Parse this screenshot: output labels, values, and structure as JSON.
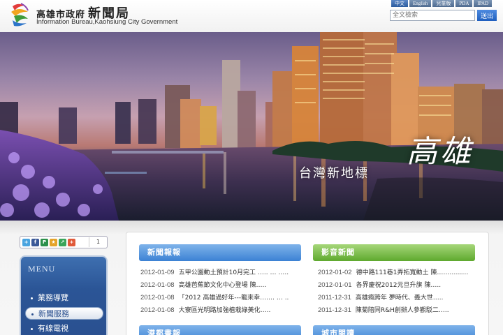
{
  "header": {
    "org_cn": "高雄市政府",
    "bureau_cn": "新聞局",
    "org_en": "Information Bureau,Kaohsiung City Government"
  },
  "lang": [
    {
      "label": "中文",
      "active": true
    },
    {
      "label": "English"
    },
    {
      "label": "兒童版"
    },
    {
      "label": "PDA"
    },
    {
      "label": "IPAD"
    }
  ],
  "search": {
    "placeholder": "全文檢索",
    "button": "送出"
  },
  "banner": {
    "title": "高雄",
    "subtitle": "台灣新地標"
  },
  "share": {
    "icons": [
      "plus-one-icon",
      "facebook-icon",
      "plurk-icon",
      "bookmark-icon",
      "share-icon",
      "add-icon"
    ],
    "count": "1"
  },
  "menu": {
    "title": "MENU",
    "items": [
      {
        "label": "業務導覽"
      },
      {
        "label": "新聞服務",
        "active": true
      },
      {
        "label": "有線電視"
      }
    ]
  },
  "sections": {
    "news": {
      "title": "新聞報報",
      "items": [
        {
          "date": "2012-01-09",
          "text": "五甲公園動土預計10月完工 ….. … ….."
        },
        {
          "date": "2012-01-08",
          "text": "高雄芭蕉節文化中心登場 陳….."
        },
        {
          "date": "2012-01-08",
          "text": "「2012 高雄過好年---龍來幸……. … .."
        },
        {
          "date": "2012-01-08",
          "text": "大寮區光明路加強植栽綠美化….."
        }
      ]
    },
    "video": {
      "title": "影音新聞",
      "items": [
        {
          "date": "2012-01-02",
          "text": "德中路111巷1弄拓寬動土 陳……………"
        },
        {
          "date": "2012-01-01",
          "text": "各界慶祝2012元旦升旗 陳….."
        },
        {
          "date": "2011-12-31",
          "text": "高雄瘋跨年 夢時代、義大世….."
        },
        {
          "date": "2011-12-31",
          "text": "陳菊陪同R&H創辦人參觀駁二….."
        }
      ]
    },
    "port": {
      "title": "港都書報"
    },
    "city": {
      "title": "城市閱讀"
    }
  },
  "colors": {
    "menu_blue": "#2b5596",
    "section_blue": "#3c82d4",
    "section_green": "#5ea92e"
  }
}
